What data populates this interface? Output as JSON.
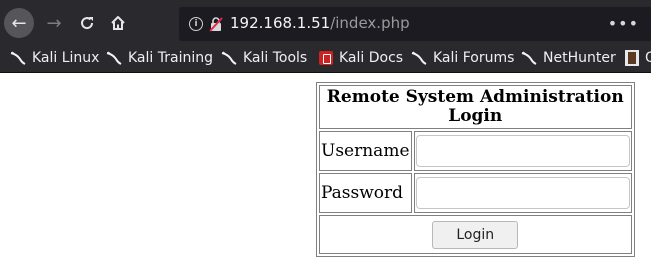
{
  "browser": {
    "url_host": "192.168.1.51",
    "url_path": "/index.php",
    "more_menu": "•••",
    "bookmarks": [
      {
        "label": "Kali Linux",
        "icon": "kali-dragon-icon"
      },
      {
        "label": "Kali Training",
        "icon": "kali-dragon-icon"
      },
      {
        "label": "Kali Tools",
        "icon": "kali-dragon-icon"
      },
      {
        "label": "Kali Docs",
        "icon": "docs-icon"
      },
      {
        "label": "Kali Forums",
        "icon": "kali-dragon-icon"
      },
      {
        "label": "NetHunter",
        "icon": "kali-dragon-icon"
      },
      {
        "label": "O",
        "icon": "bookmark-icon"
      }
    ]
  },
  "login": {
    "title": "Remote System Administration Login",
    "username_label": "Username",
    "username_value": "",
    "password_label": "Password",
    "password_value": "",
    "button_label": "Login"
  },
  "colors": {
    "chrome_bg": "#2a2a2e",
    "urlbar_bg": "#1c1b22",
    "page_bg": "#ffffff"
  }
}
